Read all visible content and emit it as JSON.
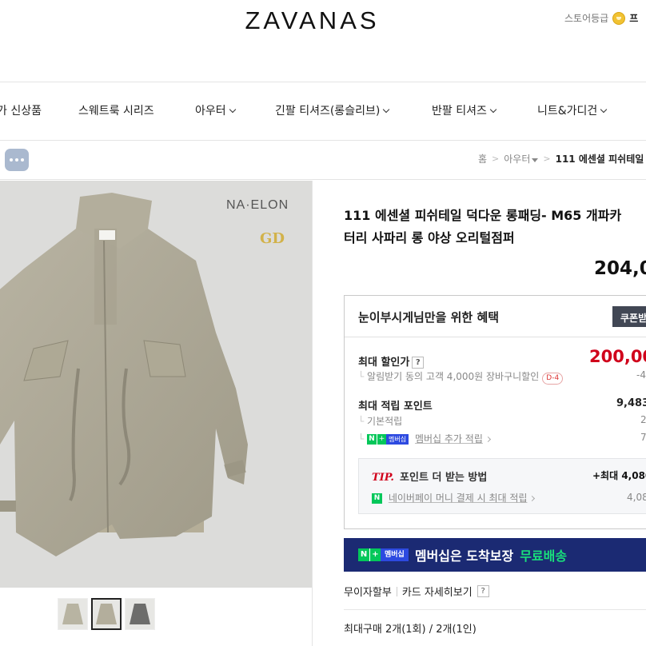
{
  "header": {
    "logo": "ZAVANAS",
    "store_grade_label": "스토어등급",
    "store_grade_extra": "프"
  },
  "menu": {
    "items": [
      {
        "label": "가 신상품",
        "dropdown": false
      },
      {
        "label": "스웨트룩 시리즈",
        "dropdown": false
      },
      {
        "label": "아우터",
        "dropdown": true
      },
      {
        "label": "긴팔 티셔즈(롱슬리브)",
        "dropdown": true
      },
      {
        "label": "반팔 티셔즈",
        "dropdown": true
      },
      {
        "label": "니트&가디건",
        "dropdown": true
      }
    ]
  },
  "breadcrumb": {
    "home": "홈",
    "category": "아우터",
    "current": "111 에센셜 피쉬테일"
  },
  "product": {
    "image_brand": "NA·ELON",
    "label_tag": "ZAVANAS",
    "title_line1": "111 에센셜 피쉬테일 덕다운 롱패딩- M65 개파카",
    "title_line2": "터리 사파리 롱 야상 오리털점퍼",
    "price": "204,0",
    "thumbnails": [
      {
        "name": "thumb-1",
        "selected": false
      },
      {
        "name": "thumb-2",
        "selected": true
      },
      {
        "name": "thumb-3",
        "selected": false
      }
    ]
  },
  "benefit": {
    "heading": "눈이부시게님만을 위한 혜택",
    "coupon_button": "쿠폰받",
    "max_discount_label": "최대 할인가",
    "max_discount_value": "200,00",
    "notify_text": "알림받기 동의 고객 4,000원 장바구니할인",
    "notify_badge": "D-4",
    "notify_value": "-4",
    "max_points_label": "최대 적립 포인트",
    "max_points_value": "9,483",
    "basic_label": "기본적립",
    "basic_value": "2",
    "membership_badge_n": "N",
    "membership_badge_plus": "+",
    "membership_badge_text": "멤버십",
    "membership_label": "멤버십 추가 적립",
    "membership_value": "7",
    "tip_label": "TIP.",
    "tip_text": "포인트 더 받는 방법",
    "tip_value": "+최대 4,080",
    "naverpay_icon": "N",
    "naverpay_text": "네이버페이 머니 결제 시 최대 적립",
    "naverpay_value": "4,08"
  },
  "banner": {
    "badge_n": "N",
    "badge_plus": "+",
    "badge_text": "멤버십",
    "text": "멤버십은 도착보장",
    "highlight": "무료배송"
  },
  "installment": {
    "label": "무이자할부",
    "card_details": "카드 자세히보기",
    "help": "?"
  },
  "max_purchase": "최대구매 2개(1회) / 2개(1인)",
  "colors": {
    "accent_red": "#d0021b",
    "naver_green": "#03c75a",
    "banner_navy": "#1b2a73"
  }
}
